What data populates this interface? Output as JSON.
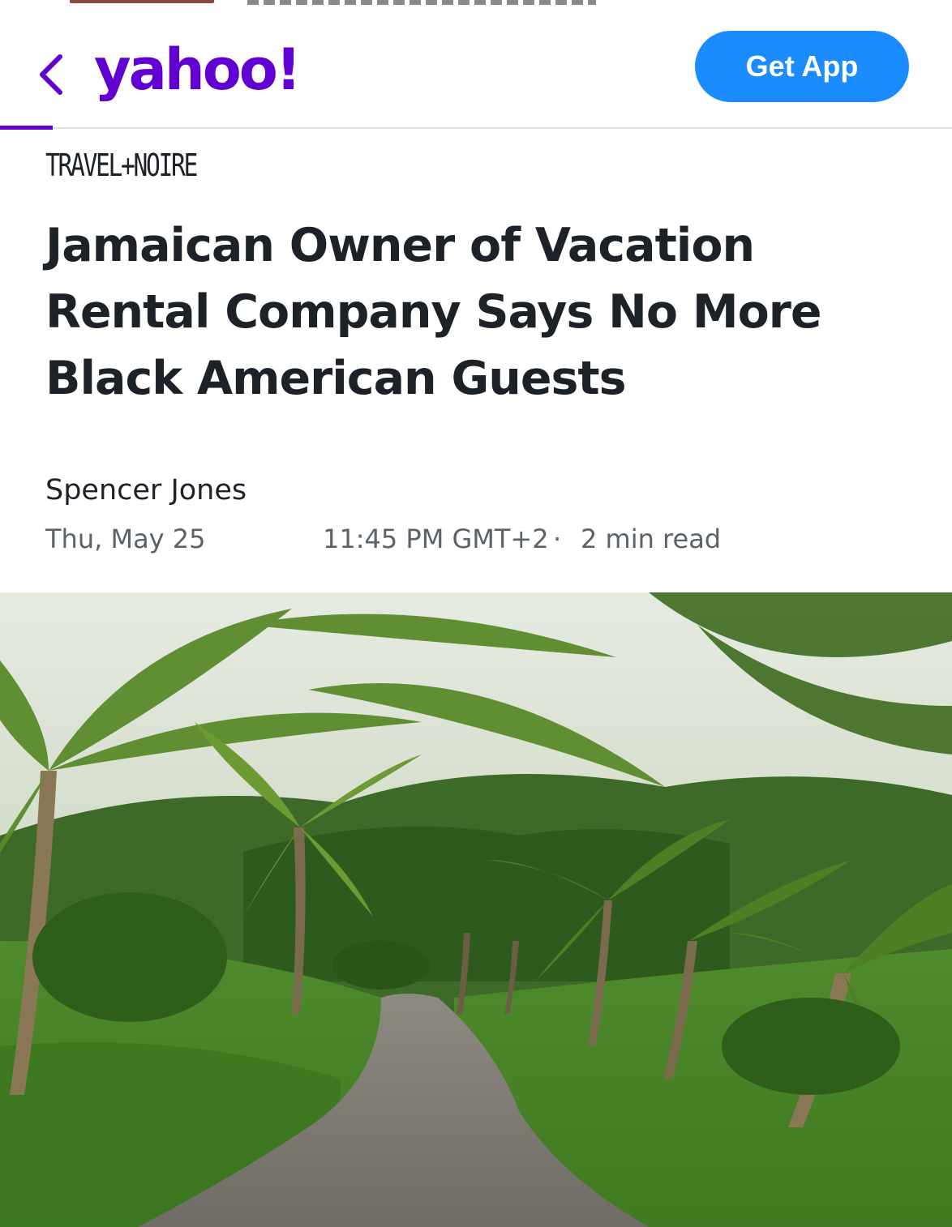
{
  "header": {
    "logo_text": "yahoo!",
    "get_app_label": "Get App",
    "back_icon": "chevron-left-icon",
    "brand_color": "#6001d2",
    "button_color": "#1a8cff"
  },
  "article": {
    "publisher": "TRAVEL+NOIRE",
    "headline": "Jamaican Owner of Vacation Rental Company Says No More Black American Guests",
    "author": "Spencer Jones",
    "date": "Thu, May 25",
    "time": "11:45 PM GMT+2",
    "separator": "·",
    "read_time": "2 min read",
    "hero_image": "palm-lined-road-photo"
  }
}
